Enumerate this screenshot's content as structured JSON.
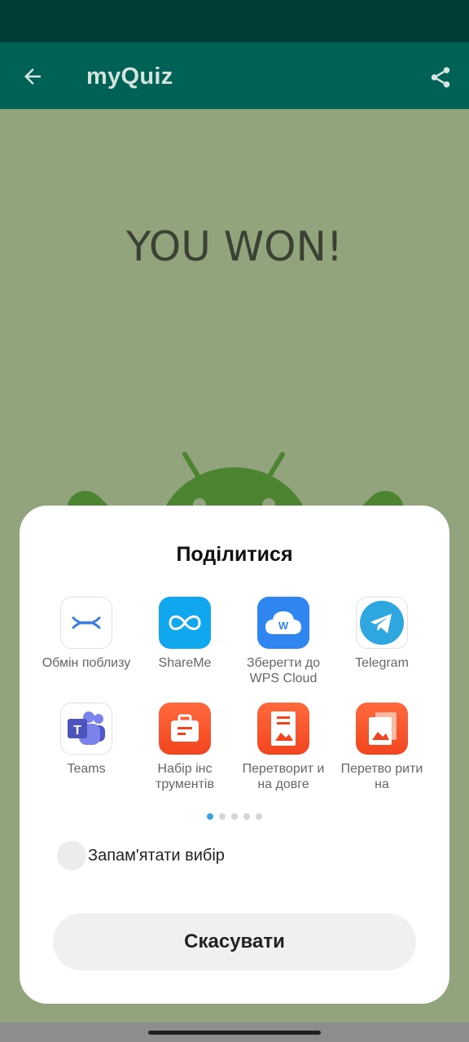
{
  "app_bar": {
    "title": "myQuiz",
    "back_icon": "arrow-back-icon",
    "share_icon": "share-icon"
  },
  "main": {
    "headline": "YOU WON!",
    "image_icon": "android-robot-icon"
  },
  "share_sheet": {
    "title": "Поділитися",
    "apps": [
      {
        "label": "Обмін поблизу",
        "icon": "nearby-share-icon"
      },
      {
        "label": "ShareMe",
        "icon": "shareme-icon"
      },
      {
        "label": "Зберегти до WPS Cloud",
        "icon": "wps-cloud-icon"
      },
      {
        "label": "Telegram",
        "icon": "telegram-icon"
      },
      {
        "label": "Teams",
        "icon": "teams-icon"
      },
      {
        "label": "Набір інс трументів",
        "icon": "toolbox-icon"
      },
      {
        "label": "Перетворит и на довге",
        "icon": "long-image-icon"
      },
      {
        "label": "Перетво рити на",
        "icon": "convert-image-icon"
      }
    ],
    "page_dots": 5,
    "active_page": 1,
    "remember_label": "Запам'ятати вибір",
    "cancel_label": "Скасувати"
  },
  "colors": {
    "status_bar": "#003d34",
    "app_bar": "#006155",
    "background": "#92a47b",
    "android_green": "#4c8432",
    "headline": "#3b4233"
  }
}
